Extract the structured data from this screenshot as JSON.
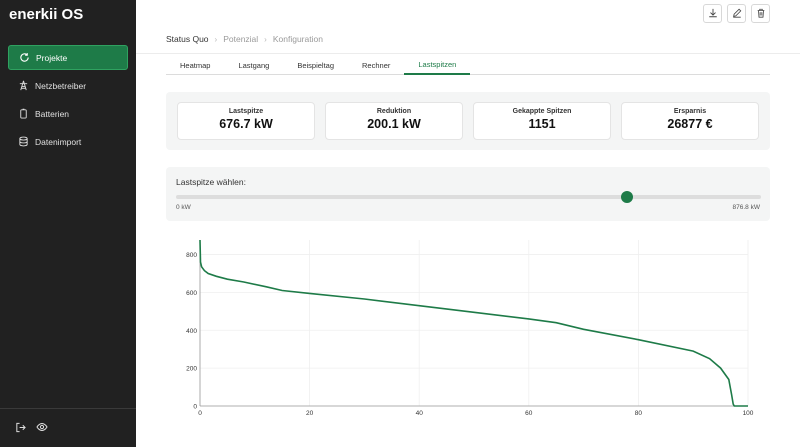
{
  "app": {
    "title": "enerkii OS"
  },
  "sidebar": {
    "items": [
      {
        "label": "Projekte",
        "icon": "refresh-icon",
        "active": true
      },
      {
        "label": "Netzbetreiber",
        "icon": "tower-icon",
        "active": false
      },
      {
        "label": "Batterien",
        "icon": "battery-icon",
        "active": false
      },
      {
        "label": "Datenimport",
        "icon": "database-icon",
        "active": false
      }
    ],
    "footer": {
      "logout_icon": "logout-icon",
      "view_icon": "eye-icon"
    }
  },
  "toolbar": {
    "icons": [
      "download-icon",
      "edit-icon",
      "trash-icon"
    ]
  },
  "breadcrumb": [
    "Status Quo",
    "Potenzial",
    "Konfiguration"
  ],
  "tabs": [
    {
      "label": "Heatmap",
      "active": false
    },
    {
      "label": "Lastgang",
      "active": false
    },
    {
      "label": "Beispieltag",
      "active": false
    },
    {
      "label": "Rechner",
      "active": false
    },
    {
      "label": "Lastspitzen",
      "active": true
    }
  ],
  "stats": [
    {
      "label": "Lastspitze",
      "value": "676.7 kW"
    },
    {
      "label": "Reduktion",
      "value": "200.1 kW"
    },
    {
      "label": "Gekappte Spitzen",
      "value": "1151"
    },
    {
      "label": "Ersparnis",
      "value": "26877 €"
    }
  ],
  "slider": {
    "title": "Lastspitze wählen:",
    "min_label": "0 kW",
    "max_label": "876.8 kW",
    "value_kw": 676.7,
    "max_kw": 876.8
  },
  "colors": {
    "accent": "#1e7b48",
    "sidebar_bg": "#212121"
  },
  "chart_data": {
    "type": "line",
    "title": "",
    "xlabel": "",
    "ylabel": "",
    "xlim": [
      0,
      100
    ],
    "ylim": [
      0,
      876.8
    ],
    "xticks": [
      0,
      20,
      40,
      60,
      80,
      100
    ],
    "yticks": [
      0,
      200,
      400,
      600,
      800
    ],
    "grid": true,
    "series": [
      {
        "color": "#1e7b48",
        "x": [
          0,
          0.1,
          0.3,
          0.8,
          1.5,
          3,
          5,
          8,
          12,
          15,
          20,
          30,
          40,
          50,
          60,
          65,
          70,
          80,
          90,
          93,
          95,
          96.5,
          97,
          97.3,
          97.5,
          98,
          100
        ],
        "y": [
          876.8,
          760,
          735,
          715,
          700,
          685,
          670,
          655,
          630,
          610,
          595,
          565,
          530,
          495,
          460,
          440,
          405,
          350,
          290,
          250,
          200,
          140,
          60,
          10,
          0,
          0,
          0
        ]
      }
    ]
  }
}
